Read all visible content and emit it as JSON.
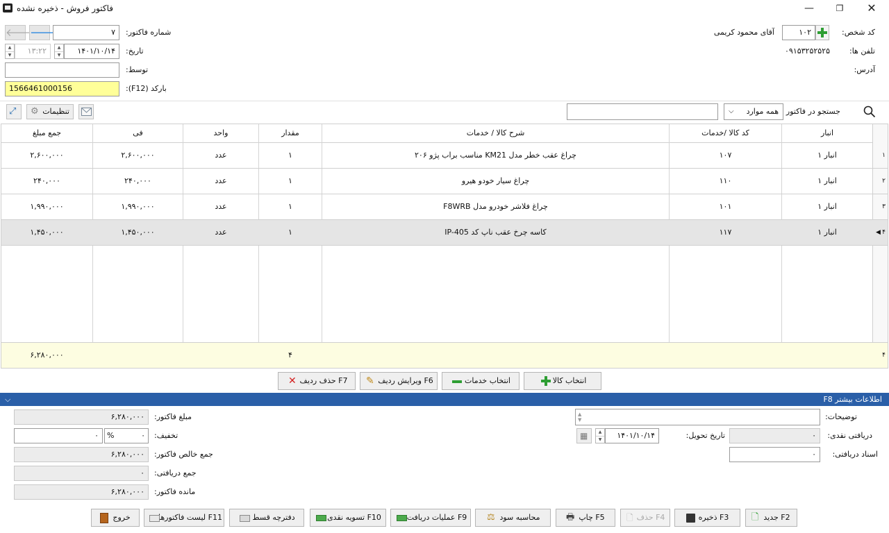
{
  "window": {
    "title": "فاکتور فروش - ذخیره نشده"
  },
  "header": {
    "person_code_label": "کد شخص:",
    "person_code": "۱۰۲",
    "person_name": "آقای محمود  کریمی",
    "phones_label": "تلفن ها:",
    "phones": "۰۹۱۵۳۲۵۲۵۲۵",
    "address_label": "آدرس:",
    "invoice_no_label": "شماره فاکتور:",
    "invoice_no": "۷",
    "date_label": "تاریخ:",
    "date": "۱۴۰۱/۱۰/۱۴",
    "time": "۱۳:۲۲",
    "by_label": "توسط:",
    "by": "",
    "barcode_label": "بارکد (F12):",
    "barcode": "1566461000156"
  },
  "search": {
    "label": "جستجو در فاکتور",
    "scope": "همه موارد",
    "query": "",
    "settings_label": "تنظیمات"
  },
  "table": {
    "columns": [
      "انبار",
      "کد کالا /خدمات",
      "شرح کالا / خدمات",
      "مقدار",
      "واحد",
      "فی",
      "جمع مبلغ"
    ],
    "rows": [
      {
        "num": "۱",
        "warehouse": "انبار ۱",
        "code": "۱۰۷",
        "desc": "چراغ عقب خطر مدل KM21 مناسب براب پژو ۲۰۶",
        "qty": "۱",
        "unit": "عدد",
        "price": "۲,۶۰۰,۰۰۰",
        "total": "۲,۶۰۰,۰۰۰"
      },
      {
        "num": "۲",
        "warehouse": "انبار ۱",
        "code": "۱۱۰",
        "desc": "چراغ سیار خودو هیرو",
        "qty": "۱",
        "unit": "عدد",
        "price": "۲۴۰,۰۰۰",
        "total": "۲۴۰,۰۰۰"
      },
      {
        "num": "۳",
        "warehouse": "انبار ۱",
        "code": "۱۰۱",
        "desc": "چراغ فلاشر خودرو مدل F8WRB",
        "qty": "۱",
        "unit": "عدد",
        "price": "۱,۹۹۰,۰۰۰",
        "total": "۱,۹۹۰,۰۰۰"
      },
      {
        "num": "۴",
        "warehouse": "انبار ۱",
        "code": "۱۱۷",
        "desc": "کاسه چرخ عقب ناپ کد IP-405",
        "qty": "۱",
        "unit": "عدد",
        "price": "۱,۴۵۰,۰۰۰",
        "total": "۱,۴۵۰,۰۰۰"
      }
    ],
    "footer": {
      "count": "۴",
      "qty_total": "۴",
      "sum_total": "۶,۲۸۰,۰۰۰"
    }
  },
  "row_actions": {
    "select_goods": "انتخاب کالا",
    "select_services": "انتخاب خدمات",
    "edit_row": "F6 ویرایش ردیف",
    "delete_row": "F7 حذف ردیف"
  },
  "more_info": {
    "title": "F8 اطلاعات بیشتر"
  },
  "details": {
    "notes_label": "توضیحات:",
    "notes": "",
    "cash_received_label": "دریافتی نقدی:",
    "cash_received": "۰",
    "delivery_date_label": "تاریخ تحویل:",
    "delivery_date": "۱۴۰۱/۱۰/۱۴",
    "docs_received_label": "اسناد دریافتی:",
    "docs_received": "۰",
    "invoice_amount_label": "مبلغ فاکتور:",
    "invoice_amount": "۶,۲۸۰,۰۰۰",
    "discount_label": "تخفیف:",
    "discount_percent": "۰",
    "percent_sign": "%",
    "discount_amount": "۰",
    "net_total_label": "جمع خالص فاکتور:",
    "net_total": "۶,۲۸۰,۰۰۰",
    "total_received_label": "جمع دریافتی:",
    "total_received": "۰",
    "remaining_label": "مانده فاکتور:",
    "remaining": "۶,۲۸۰,۰۰۰"
  },
  "footer_buttons": {
    "new": "F2 جدید",
    "save": "F3 ذخیره",
    "delete": "F4 حذف",
    "print": "F5 چاپ",
    "profit": "محاسبه سود",
    "receipt_ops": "F9 عملیات دریافت",
    "cash_settle": "F10 تسویه نقدی",
    "installments": "دفترچه قسط",
    "invoice_list": "F11 لیست فاکتورها",
    "exit": "خروج"
  }
}
